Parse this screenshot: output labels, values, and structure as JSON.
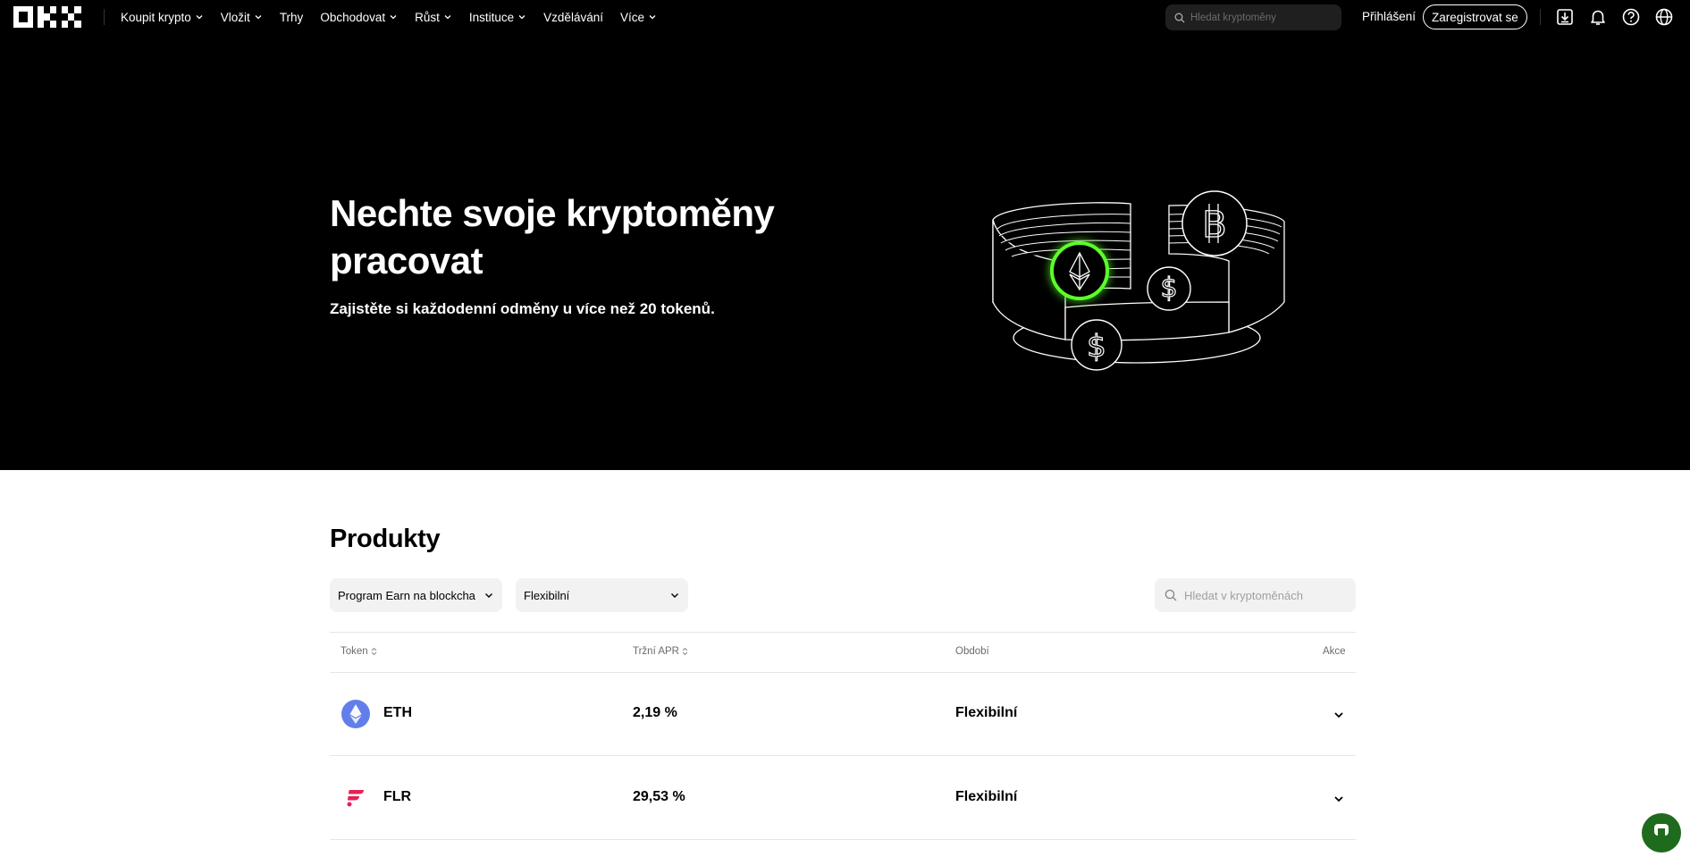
{
  "nav": {
    "menu": [
      {
        "label": "Koupit krypto",
        "has_dropdown": true
      },
      {
        "label": "Vložit",
        "has_dropdown": true
      },
      {
        "label": "Trhy",
        "has_dropdown": false
      },
      {
        "label": "Obchodovat",
        "has_dropdown": true
      },
      {
        "label": "Růst",
        "has_dropdown": true
      },
      {
        "label": "Instituce",
        "has_dropdown": true
      },
      {
        "label": "Vzdělávání",
        "has_dropdown": false
      },
      {
        "label": "Více",
        "has_dropdown": true
      }
    ],
    "search_placeholder": "Hledat kryptoměny",
    "login_label": "Přihlášení",
    "register_label": "Zaregistrovat se",
    "icons": [
      "download-icon",
      "bell-icon",
      "help-icon",
      "globe-icon"
    ]
  },
  "hero": {
    "title": "Nechte svoje kryptoměny pracovat",
    "subtitle": "Zajistěte si každodenní odměny u více než 20 tokenů."
  },
  "products": {
    "title": "Produkty",
    "filter_type": "Program Earn na blockcha",
    "filter_term": "Flexibilní",
    "search_placeholder": "Hledat v kryptoměnách",
    "columns": {
      "token": "Token",
      "apr": "Tržní APR",
      "period": "Období",
      "action": "Akce"
    },
    "rows": [
      {
        "token": "ETH",
        "apr": "2,19 %",
        "period": "Flexibilní",
        "icon": "eth-icon",
        "color": "#627EEA"
      },
      {
        "token": "FLR",
        "apr": "29,53 %",
        "period": "Flexibilní",
        "icon": "flr-icon",
        "color": "#E62058"
      }
    ]
  },
  "colors": {
    "hero_bg": "#000000",
    "accent_green": "#5CFF2A",
    "chat_fab": "#1E6B1E"
  }
}
